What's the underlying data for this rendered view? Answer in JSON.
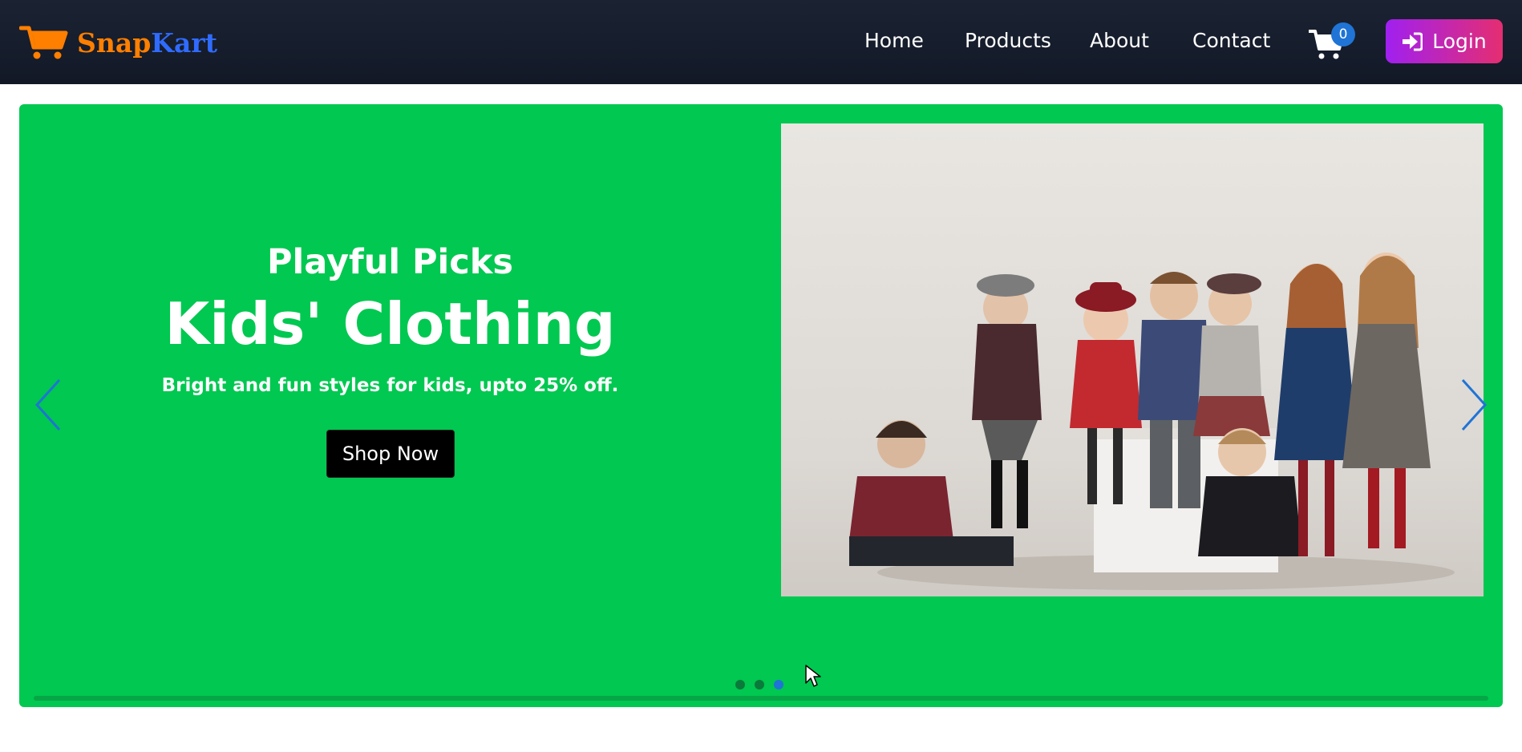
{
  "brand": {
    "name_part1": "Snap",
    "name_part2": "Kart",
    "logo_icon": "shopping-cart-icon"
  },
  "nav": {
    "items": [
      {
        "label": "Home"
      },
      {
        "label": "Products"
      },
      {
        "label": "About"
      },
      {
        "label": "Contact"
      }
    ],
    "cart_count": "0",
    "login_label": "Login"
  },
  "hero": {
    "subtitle": "Playful Picks",
    "title": "Kids' Clothing",
    "description": "Bright and fun styles for kids, upto 25% off.",
    "cta_label": "Shop Now",
    "slides": {
      "total": 3,
      "active": 3
    }
  },
  "colors": {
    "navbar_bg": "#121826",
    "hero_bg": "#00c850",
    "brand_snap": "#ff7f00",
    "brand_kart": "#2f6bff",
    "accent_blue": "#1f74d6",
    "login_gradient_start": "#a020f0",
    "login_gradient_end": "#e52e71"
  }
}
